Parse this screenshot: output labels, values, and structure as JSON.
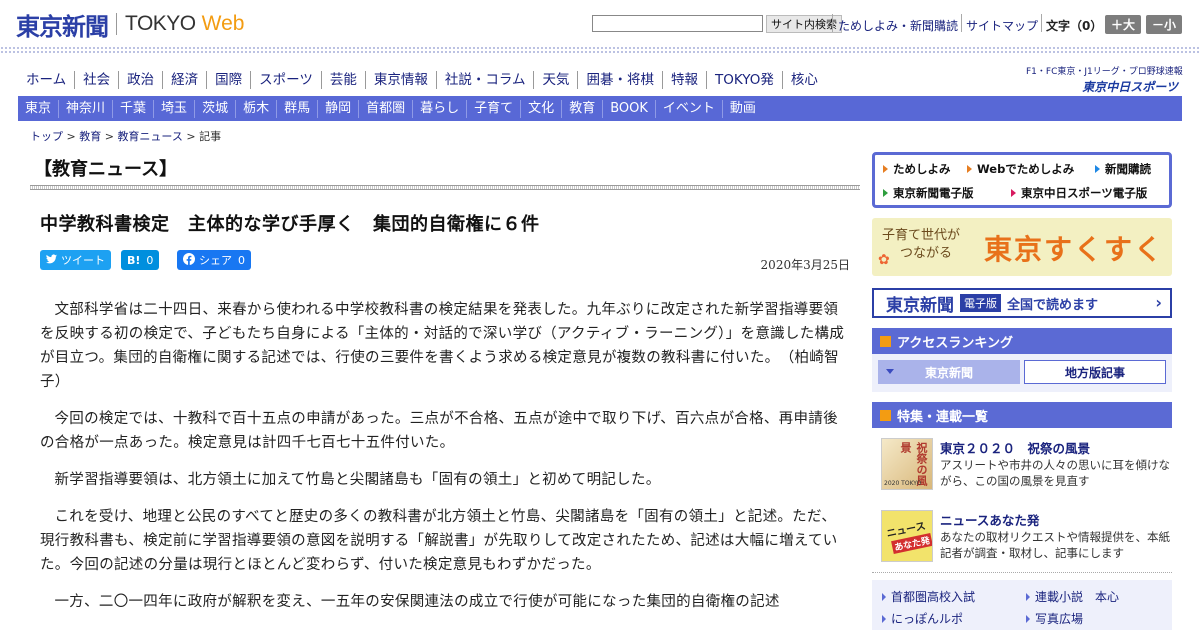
{
  "header": {
    "logo_main": "東京新聞",
    "logo_sub": "TOKYO",
    "logo_web": "Web",
    "search_placeholder": "",
    "search_button": "サイト内検索",
    "link_trial": "ためしよみ・新聞購読",
    "link_sitemap": "サイトマップ",
    "font_size_label": "文字（0）",
    "font_larger": "＋大",
    "font_smaller": "－小"
  },
  "main_nav": [
    "ホーム",
    "社会",
    "政治",
    "経済",
    "国際",
    "スポーツ",
    "芸能",
    "東京情報",
    "社説・コラム",
    "天気",
    "囲碁・将棋",
    "特報",
    "TOKYO発",
    "核心"
  ],
  "chunichi": {
    "line1": "F1・FC東京・J1リーグ・プロ野球速報",
    "line2": "東京中日スポーツ"
  },
  "sub_nav": [
    "東京",
    "神奈川",
    "千葉",
    "埼玉",
    "茨城",
    "栃木",
    "群馬",
    "静岡",
    "首都圏",
    "暮らし",
    "子育て",
    "文化",
    "教育",
    "BOOK",
    "イベント",
    "動画"
  ],
  "breadcrumb": {
    "top": "トップ",
    "education": "教育",
    "news": "教育ニュース",
    "current": "記事",
    "sep": " > "
  },
  "section_title": "【教育ニュース】",
  "article": {
    "headline": "中学教科書検定　主体的な学び手厚く　集団的自衛権に６件",
    "date": "2020年3月25日",
    "share": {
      "tweet": "ツイート",
      "hatena_label": "B!",
      "hatena_count": "0",
      "fb_label": "シェア",
      "fb_count": "0"
    },
    "paragraphs": [
      "文部科学省は二十四日、来春から使われる中学校教科書の検定結果を発表した。九年ぶりに改定された新学習指導要領を反映する初の検定で、子どもたち自身による「主体的・対話的で深い学び（アクティブ・ラーニング）」を意識した構成が目立つ。集団的自衛権に関する記述では、行使の三要件を書くよう求める検定意見が複数の教科書に付いた。　（柏崎智子）",
      "今回の検定では、十教科で百十五点の申請があった。三点が不合格、五点が途中で取り下げ、百六点が合格、再申請後の合格が一点あった。検定意見は計四千七百七十五件付いた。",
      "新学習指導要領は、北方領土に加えて竹島と尖閣諸島も「固有の領土」と初めて明記した。",
      "これを受け、地理と公民のすべてと歴史の多くの教科書が北方領土と竹島、尖閣諸島を「固有の領土」と記述。ただ、現行教科書も、検定前に学習指導要領の意図を説明する「解説書」が先取りして改定されたため、記述は大幅に増えていた。今回の記述の分量は現行とほとんど変わらず、付いた検定意見もわずかだった。",
      "一方、二〇一四年に政府が解釈を変え、一五年の安保関連法の成立で行使が可能になった集団的自衛権の記述"
    ]
  },
  "sidebar": {
    "promo": {
      "trial": "ためしよみ",
      "web_trial": "Webでためしよみ",
      "subscribe": "新聞購読",
      "e_paper": "東京新聞電子版",
      "chunichi_e": "東京中日スポーツ電子版"
    },
    "sukusuku": {
      "line1": "子育て世代が",
      "line2": "つながる",
      "brand": "東京すくすく"
    },
    "denshi": {
      "logo": "東京新聞",
      "tag": "電子版",
      "text": "全国で読めます"
    },
    "ranking": {
      "title": "アクセスランキング",
      "tab_tokyo": "東京新聞",
      "tab_local": "地方版記事"
    },
    "features": {
      "title": "特集・連載一覧",
      "items": [
        {
          "title": "東京２０２０　祝祭の風景",
          "desc": "アスリートや市井の人々の思いに耳を傾けながら、この国の風景を見直す",
          "thumb_text": "祝祭の風景",
          "thumb_sub": "2020 TOKYO"
        },
        {
          "title": "ニュースあなた発",
          "desc": "あなたの取材リクエストや情報提供を、本紙記者が調査・取材し、記事にします",
          "thumb_text": "ニュース",
          "thumb_sub": "あなた発"
        }
      ]
    },
    "links": [
      "首都圏高校入試",
      "連載小説　本心",
      "にっぽんルポ",
      "写真広場"
    ]
  },
  "colors": {
    "nav_bg": "#5868d6",
    "logo_blue": "#2b3fa6",
    "accent_orange": "#f39c12"
  }
}
